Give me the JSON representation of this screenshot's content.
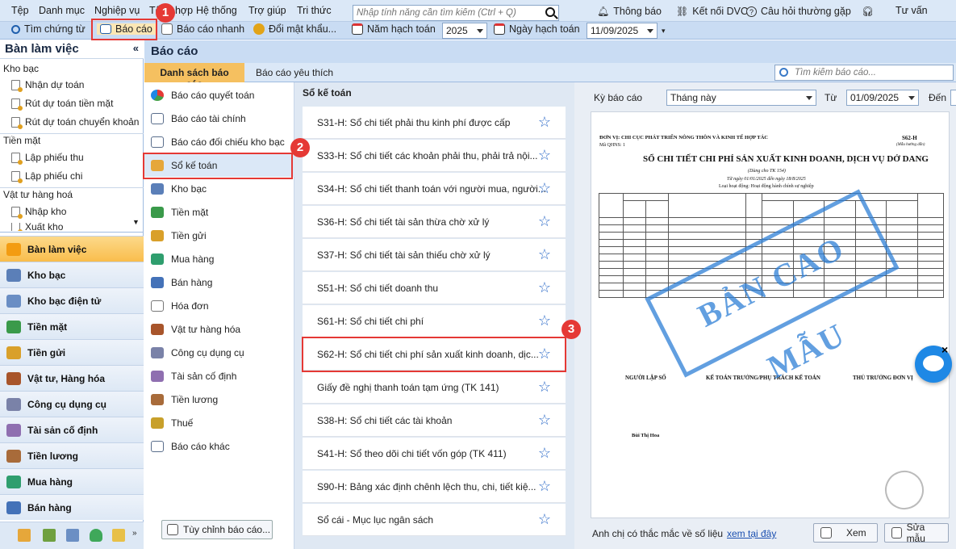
{
  "menubar": {
    "items": [
      "Tệp",
      "Danh mục",
      "Nghiệp vụ",
      "Tổng hợp",
      "Hệ thống",
      "Trợ giúp",
      "Tri thức"
    ],
    "search_placeholder": "Nhập tính năng cần tìm kiếm (Ctrl + Q)",
    "notification": "Thông báo",
    "connect": "Kết nối DVC",
    "faq": "Câu hỏi thường gặp",
    "consult": "Tư vấn"
  },
  "toolbar": {
    "find_voucher": "Tìm chứng từ",
    "report": "Báo cáo",
    "quick_report": "Báo cáo nhanh",
    "change_password": "Đổi mật khẩu...",
    "fiscal_year_label": "Năm hạch toán",
    "fiscal_year_value": "2025",
    "accounting_date_label": "Ngày hạch toán",
    "accounting_date_value": "11/09/2025"
  },
  "left": {
    "title": "Bàn làm việc",
    "groups": [
      {
        "label": "Kho bạc",
        "items": [
          "Nhận dự toán",
          "Rút dự toán tiền mặt",
          "Rút dự toán chuyển khoản"
        ]
      },
      {
        "label": "Tiền mặt",
        "items": [
          "Lập phiếu thu",
          "Lập phiếu chi"
        ]
      },
      {
        "label": "Vật tư hàng hoá",
        "items": [
          "Nhập kho",
          "Xuất kho"
        ]
      }
    ],
    "nav": [
      "Bàn làm việc",
      "Kho bạc",
      "Kho bạc điện tử",
      "Tiền mặt",
      "Tiền gửi",
      "Vật tư, Hàng hóa",
      "Công cụ dụng cụ",
      "Tài sản cố định",
      "Tiền lương",
      "Mua hàng",
      "Bán hàng"
    ]
  },
  "main": {
    "title": "Báo cáo",
    "tabs": [
      "Danh sách báo cáo",
      "Báo cáo yêu thích"
    ],
    "search_placeholder": "Tìm kiếm báo cáo..."
  },
  "categories": [
    "Báo cáo quyết toán",
    "Báo cáo tài chính",
    "Báo cáo đối chiếu kho bạc",
    "Sổ kế toán",
    "Kho bạc",
    "Tiền mặt",
    "Tiền gửi",
    "Mua hàng",
    "Bán hàng",
    "Hóa đơn",
    "Vật tư hàng hóa",
    "Công cụ dụng cụ",
    "Tài sản cố định",
    "Tiền lương",
    "Thuế",
    "Báo cáo khác"
  ],
  "custom_report_button": "Tùy chỉnh báo cáo...",
  "report_list": {
    "header": "Sổ kế toán",
    "items": [
      "S31-H: Sổ chi tiết phải thu kinh phí được cấp",
      "S33-H: Sổ chi tiết các khoản phải thu, phải trả nội...",
      "S34-H: Sổ chi tiết thanh toán với người mua, người...",
      "S36-H: Sổ chi tiết tài sản thừa chờ xử lý",
      "S37-H: Sổ chi tiết tài sản thiếu chờ xử lý",
      "S51-H: Sổ chi tiết doanh thu",
      "S61-H: Sổ chi tiết chi phí",
      "S62-H: Sổ chi tiết chi phí sản xuất kinh doanh, dịc...",
      "Giấy đề nghị thanh toán tạm ứng (TK 141)",
      "S38-H: Sổ chi tiết các tài khoản",
      "S41-H: Sổ theo dõi chi tiết vốn góp (TK 411)",
      "S90-H: Bảng xác định chênh lệch thu, chi, tiết kiệ...",
      "Sổ cái - Mục lục ngân sách"
    ]
  },
  "preview": {
    "period_label": "Kỳ báo cáo",
    "period_value": "Tháng này",
    "from_label": "Từ",
    "from_value": "01/09/2025",
    "to_label": "Đến",
    "org": "ĐƠN VỊ: CHI CỤC PHÁT TRIỂN NÔNG THÔN VÀ KINH TẾ HỢP TÁC",
    "qhns": "Mã QHNS: 1",
    "form_code": "S62-H",
    "form_note": "(Mẫu hướng dẫn)",
    "title": "SỔ CHI TIẾT CHI PHÍ SẢN XUẤT KINH DOANH, DỊCH VỤ DỞ DANG",
    "subtitle": "(Dùng cho TK 154)",
    "date_range": "Từ ngày 01/01/2025 đến ngày 18/8/2025",
    "activity": "Loại hoạt động: Hoạt động hành chính sự nghiệp",
    "stamp": "BẢN CAO MẪU",
    "signer1": "NGƯỜI LẬP SỔ",
    "signer2": "KẾ TOÁN TRƯỞNG/PHỤ TRÁCH KẾ TOÁN",
    "signer3": "THỦ TRƯỞNG ĐƠN VỊ",
    "signer_name": "Bùi Thị Hoa",
    "footer_question": "Anh chị có thắc mắc về số liệu",
    "footer_link": "xem tại đây",
    "view_button": "Xem",
    "edit_button": "Sửa mẫu"
  },
  "callouts": [
    "1",
    "2",
    "3"
  ]
}
